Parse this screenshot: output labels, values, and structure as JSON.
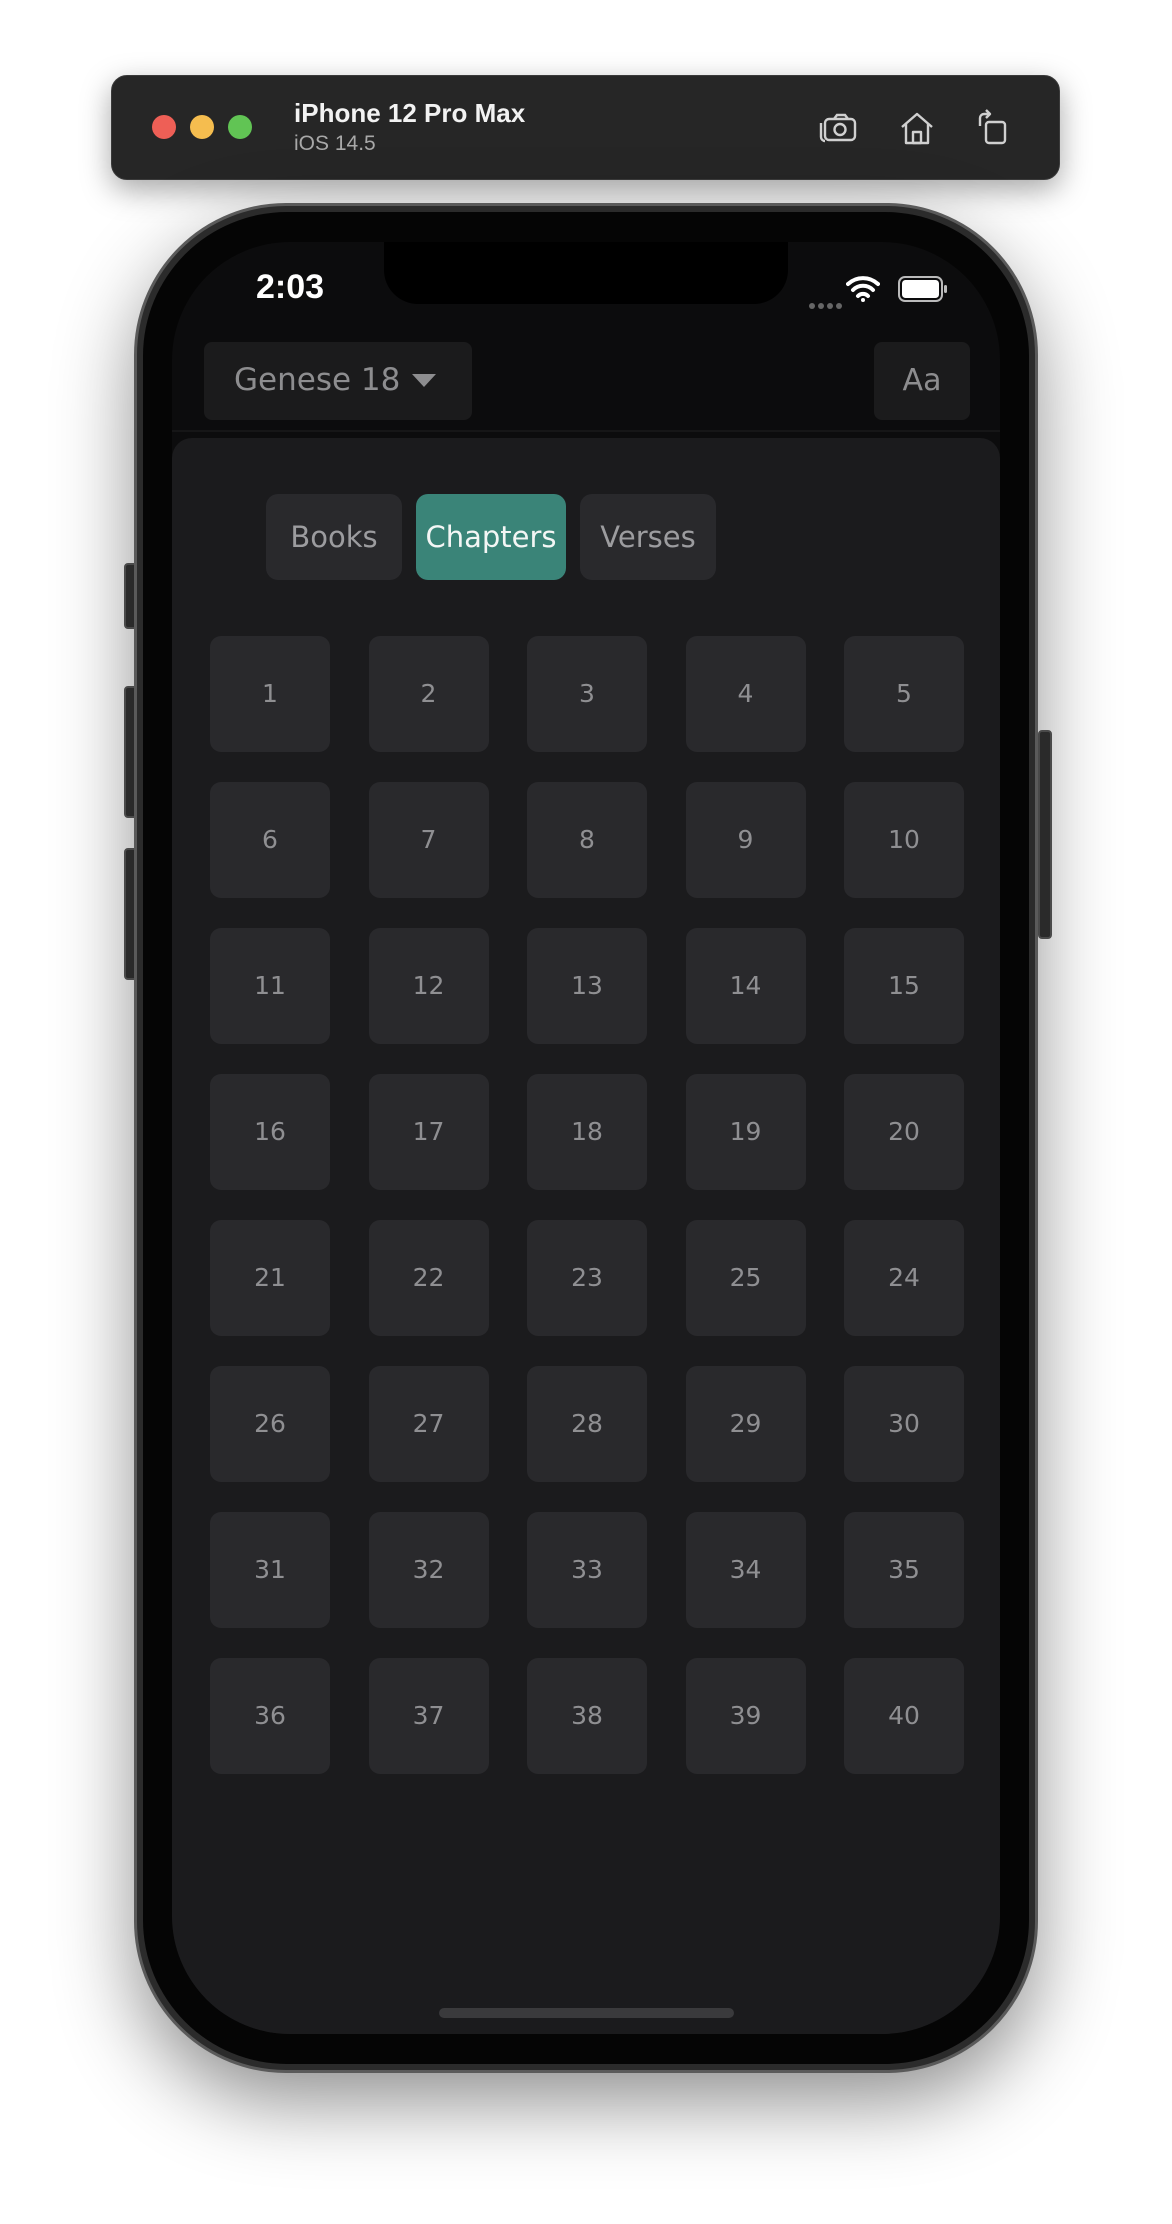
{
  "simulator": {
    "device_name": "iPhone 12 Pro Max",
    "os_version": "iOS 14.5",
    "icons": [
      "screenshot-icon",
      "home-icon",
      "rotate-icon"
    ]
  },
  "status_bar": {
    "time": "2:03",
    "icons": [
      "cellular-icon",
      "wifi-icon",
      "battery-icon"
    ]
  },
  "header": {
    "book_selector": "Genese 18",
    "font_button": "Aa"
  },
  "tabs": [
    {
      "label": "Books",
      "active": false
    },
    {
      "label": "Chapters",
      "active": true
    },
    {
      "label": "Verses",
      "active": false
    }
  ],
  "chapters": [
    "1",
    "2",
    "3",
    "4",
    "5",
    "6",
    "7",
    "8",
    "9",
    "10",
    "11",
    "12",
    "13",
    "14",
    "15",
    "16",
    "17",
    "18",
    "19",
    "20",
    "21",
    "22",
    "23",
    "25",
    "24",
    "26",
    "27",
    "28",
    "29",
    "30",
    "31",
    "32",
    "33",
    "34",
    "35",
    "36",
    "37",
    "38",
    "39",
    "40"
  ],
  "colors": {
    "accent": "#3a8478",
    "panel_background": "#1b1b1d",
    "button_background": "#29292c",
    "text_muted": "#8f8f92"
  }
}
